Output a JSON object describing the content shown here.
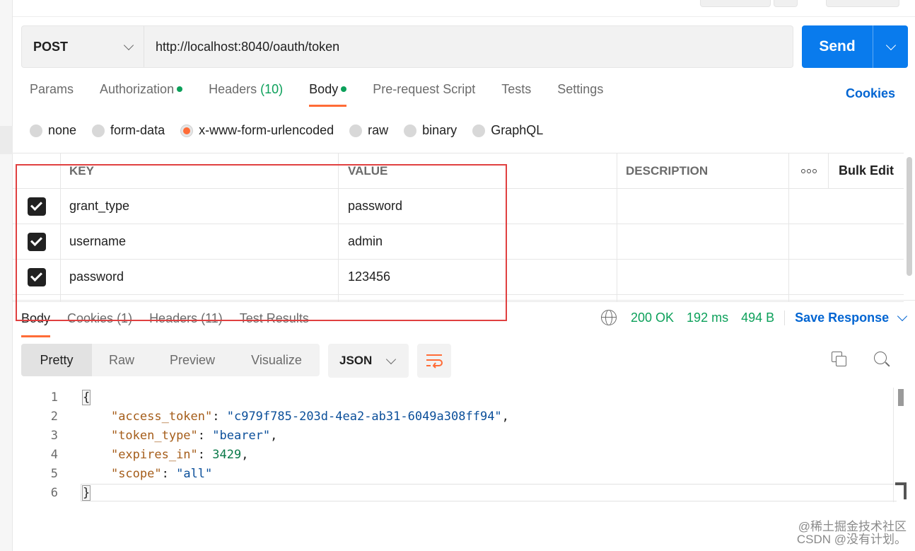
{
  "request": {
    "method": "POST",
    "url": "http://localhost:8040/oauth/token",
    "send_label": "Send"
  },
  "request_tabs": [
    {
      "label": "Params"
    },
    {
      "label": "Authorization"
    },
    {
      "label": "Headers",
      "count": "(10)"
    },
    {
      "label": "Body"
    },
    {
      "label": "Pre-request Script"
    },
    {
      "label": "Tests"
    },
    {
      "label": "Settings"
    }
  ],
  "cookies_link": "Cookies",
  "body_types": [
    "none",
    "form-data",
    "x-www-form-urlencoded",
    "raw",
    "binary",
    "GraphQL"
  ],
  "selected_body_type": "x-www-form-urlencoded",
  "params_table": {
    "headers": {
      "key": "KEY",
      "value": "VALUE",
      "description": "DESCRIPTION",
      "bulk_edit": "Bulk Edit"
    },
    "rows": [
      {
        "key": "grant_type",
        "value": "password",
        "description": ""
      },
      {
        "key": "username",
        "value": "admin",
        "description": ""
      },
      {
        "key": "password",
        "value": "123456",
        "description": ""
      }
    ]
  },
  "response": {
    "tabs": [
      "Body",
      "Cookies (1)",
      "Headers (11)",
      "Test Results"
    ],
    "status": "200 OK",
    "time": "192 ms",
    "size": "494 B",
    "save_label": "Save Response",
    "view_modes": [
      "Pretty",
      "Raw",
      "Preview",
      "Visualize"
    ],
    "format": "JSON",
    "code": {
      "l1": "{",
      "access_token_key": "\"access_token\"",
      "access_token_val": "\"c979f785-203d-4ea2-ab31-6049a308ff94\"",
      "token_type_key": "\"token_type\"",
      "token_type_val": "\"bearer\"",
      "expires_in_key": "\"expires_in\"",
      "expires_in_val": "3429",
      "scope_key": "\"scope\"",
      "scope_val": "\"all\"",
      "l6": "}"
    },
    "line_numbers": [
      "1",
      "2",
      "3",
      "4",
      "5",
      "6"
    ]
  },
  "watermark": {
    "line1": "@稀土掘金技术社区",
    "line2": "CSDN @没有计划。"
  },
  "colors": {
    "send_blue": "#097bed",
    "accent_orange": "#ff6c37",
    "status_green": "#0ca05a",
    "link_blue": "#0265d2",
    "highlight_red": "#e04040"
  }
}
